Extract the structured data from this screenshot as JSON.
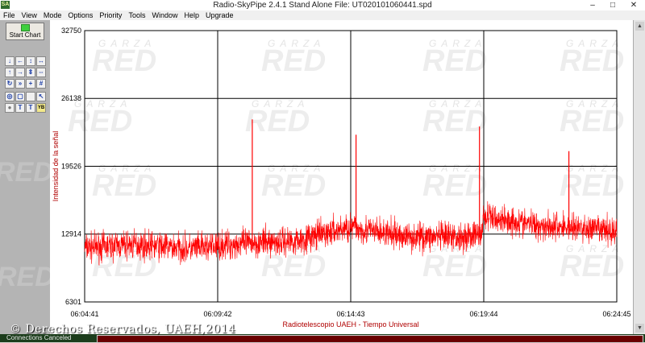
{
  "window": {
    "app_icon": "SA",
    "title": "Radio-SkyPipe   2.4.1    Stand Alone    File: UT020101060441.spd",
    "controls": [
      "–",
      "□",
      "✕"
    ]
  },
  "menu": [
    "File",
    "View",
    "Mode",
    "Options",
    "Priority",
    "Tools",
    "Window",
    "Help",
    "Upgrade"
  ],
  "toolbar": {
    "start_chart_label": "Start Chart",
    "buttons": [
      {
        "name": "arrow-down-icon",
        "glyph": "↓"
      },
      {
        "name": "arrow-left-icon",
        "glyph": "←"
      },
      {
        "name": "expand-vertical-icon",
        "glyph": "↕"
      },
      {
        "name": "expand-horizontal-icon",
        "glyph": "↔"
      },
      {
        "name": "arrow-up-icon",
        "glyph": "↑"
      },
      {
        "name": "arrow-right-icon",
        "glyph": "→"
      },
      {
        "name": "compress-vertical-icon",
        "glyph": "⇕"
      },
      {
        "name": "compress-horizontal-icon",
        "glyph": "⇔"
      },
      {
        "name": "refresh-icon",
        "glyph": "↻"
      },
      {
        "name": "fast-forward-icon",
        "glyph": "»"
      },
      {
        "name": "crosshair-icon",
        "glyph": "+"
      },
      {
        "name": "grid-icon",
        "glyph": "#"
      },
      {
        "name": "target-icon",
        "glyph": "◎"
      },
      {
        "name": "select-box-icon",
        "glyph": "▢"
      },
      {
        "name": "blank-icon",
        "glyph": " "
      },
      {
        "name": "cursor-icon",
        "glyph": "↖"
      },
      {
        "name": "record-icon",
        "glyph": "●"
      },
      {
        "name": "text-icon",
        "glyph": "T"
      },
      {
        "name": "text-frame-icon",
        "glyph": "T"
      },
      {
        "name": "yb-icon",
        "glyph": "YB"
      }
    ]
  },
  "watermark": {
    "line1": "GARZA",
    "line2": "RED"
  },
  "chart_data": {
    "type": "line",
    "title": "",
    "xlabel": "Radiotelescopio UAEH - Tiempo Universal",
    "ylabel": "Intensidad de la señal",
    "x_ticks": [
      "06:04:41",
      "06:09:42",
      "06:14:43",
      "06:19:44",
      "06:24:45"
    ],
    "y_ticks": [
      "32750",
      "26138",
      "19526",
      "12914",
      "6301"
    ],
    "ylim": [
      6301,
      32750
    ],
    "grid": true,
    "series": [
      {
        "color": "#ff0000",
        "baseline_points": [
          {
            "t": 0.0,
            "v": 11600
          },
          {
            "t": 0.1,
            "v": 11900
          },
          {
            "t": 0.2,
            "v": 11500
          },
          {
            "t": 0.3,
            "v": 12000
          },
          {
            "t": 0.4,
            "v": 12300
          },
          {
            "t": 0.5,
            "v": 13600
          },
          {
            "t": 0.55,
            "v": 13100
          },
          {
            "t": 0.6,
            "v": 12700
          },
          {
            "t": 0.7,
            "v": 12600
          },
          {
            "t": 0.745,
            "v": 12900
          },
          {
            "t": 0.75,
            "v": 14600
          },
          {
            "t": 0.85,
            "v": 13800
          },
          {
            "t": 1.0,
            "v": 13200
          }
        ],
        "noise_amplitude": 1500,
        "spikes": [
          {
            "t": 0.315,
            "v": 24100
          },
          {
            "t": 0.51,
            "v": 22600
          },
          {
            "t": 0.742,
            "v": 23400
          },
          {
            "t": 0.91,
            "v": 21000
          }
        ]
      }
    ]
  },
  "status": {
    "message": "Connections Canceled"
  },
  "copyright": "© Derechos Reservados, UAEH,2014"
}
